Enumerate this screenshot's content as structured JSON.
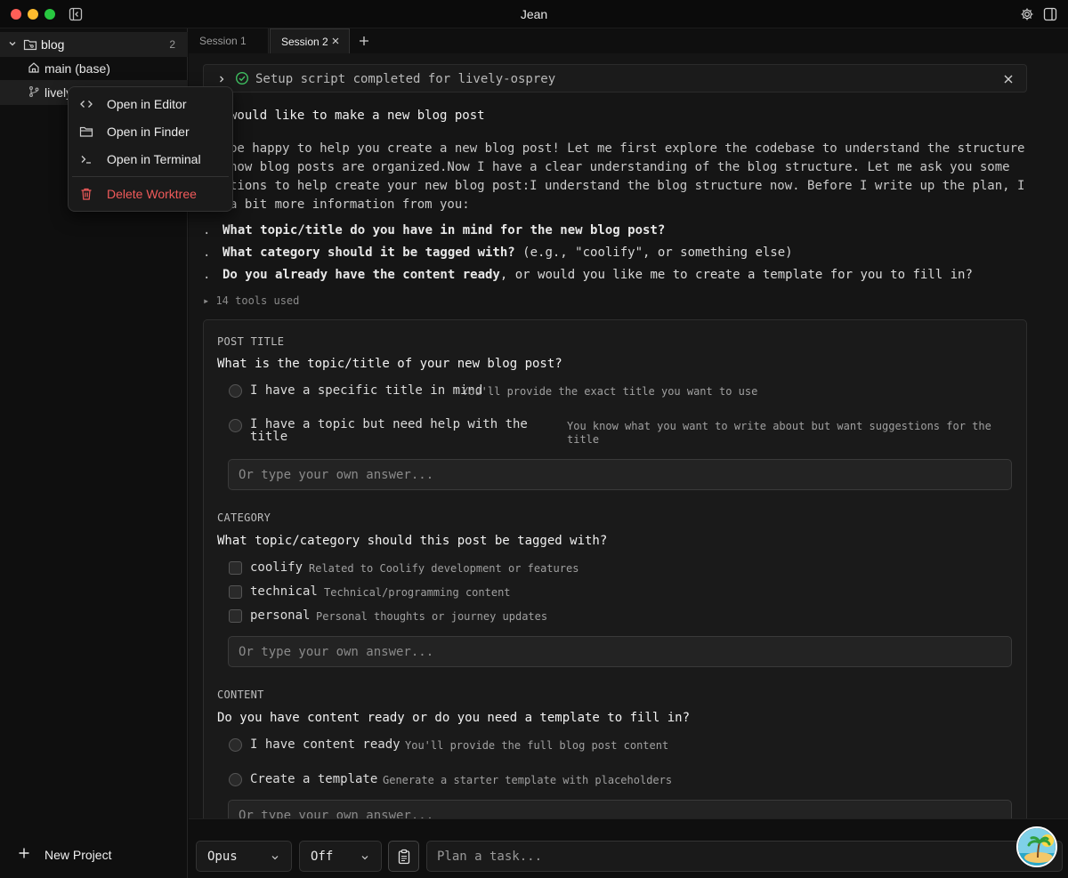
{
  "window": {
    "title": "Jean"
  },
  "sidebar": {
    "project": {
      "name": "blog",
      "count": "2"
    },
    "worktrees": [
      {
        "label": "main (base)",
        "icon": "home-icon"
      },
      {
        "label": "lively",
        "icon": "git-branch-icon"
      }
    ],
    "new_project_label": "New Project"
  },
  "context_menu": {
    "items": [
      {
        "label": "Open in Editor",
        "icon": "code-icon"
      },
      {
        "label": "Open in Finder",
        "icon": "folder-icon"
      },
      {
        "label": "Open in Terminal",
        "icon": "terminal-icon"
      },
      {
        "label": "Delete Worktree",
        "icon": "trash-icon"
      }
    ]
  },
  "tabs": [
    {
      "label": "Session 1",
      "active": false
    },
    {
      "label": "Session 2",
      "active": true
    }
  ],
  "chat": {
    "setup_status": "Setup script completed for lively-osprey",
    "user_message": "would like to make a new blog post",
    "assistant_text": "be happy to help you create a new blog post! Let me first explore the codebase to understand the structure how blog posts are organized.Now I have a clear understanding of the blog structure. Let me ask you some tions to help create your new blog post:I understand the blog structure now. Before I write up the plan, I a bit more information from you:",
    "questions": [
      {
        "bullet": ".",
        "bold": "What topic/title do you have in mind for the new blog post?",
        "rest": ""
      },
      {
        "bullet": ".",
        "bold": "What category should it be tagged with?",
        "rest": " (e.g., \"coolify\", or something else)"
      },
      {
        "bullet": ".",
        "bold": "Do you already have the content ready",
        "rest": ", or would you like me to create a template for you to fill in?"
      }
    ],
    "tools_used": "▸ 14 tools used"
  },
  "question_panel": {
    "sections": [
      {
        "label": "POST TITLE",
        "question": "What is the topic/title of your new blog post?",
        "kind": "radio",
        "options": [
          {
            "title": "I have a specific title in mind",
            "desc": "You'll provide the exact title you want to use"
          },
          {
            "title": "I have a topic but need help with the title",
            "desc": "You know what you want to write about but want suggestions for the title"
          }
        ],
        "other_placeholder": "Or type your own answer..."
      },
      {
        "label": "CATEGORY",
        "question": "What topic/category should this post be tagged with?",
        "kind": "checkbox",
        "options": [
          {
            "title": "coolify",
            "desc": "Related to Coolify development or features"
          },
          {
            "title": "technical",
            "desc": "Technical/programming content"
          },
          {
            "title": "personal",
            "desc": "Personal thoughts or journey updates"
          }
        ],
        "other_placeholder": "Or type your own answer..."
      },
      {
        "label": "CONTENT",
        "question": "Do you have content ready or do you need a template to fill in?",
        "kind": "radio",
        "options": [
          {
            "title": "I have content ready",
            "desc": "You'll provide the full blog post content"
          },
          {
            "title": "Create a template",
            "desc": "Generate a starter template with placeholders"
          }
        ],
        "other_placeholder": "Or type your own answer..."
      }
    ]
  },
  "bottom_bar": {
    "model": "Opus",
    "thinking": "Off",
    "plan_icon": "clipboard-icon",
    "task_placeholder": "Plan a task..."
  },
  "colors": {
    "danger": "#f05a5a",
    "success": "#3fbf60",
    "background": "#151515"
  }
}
